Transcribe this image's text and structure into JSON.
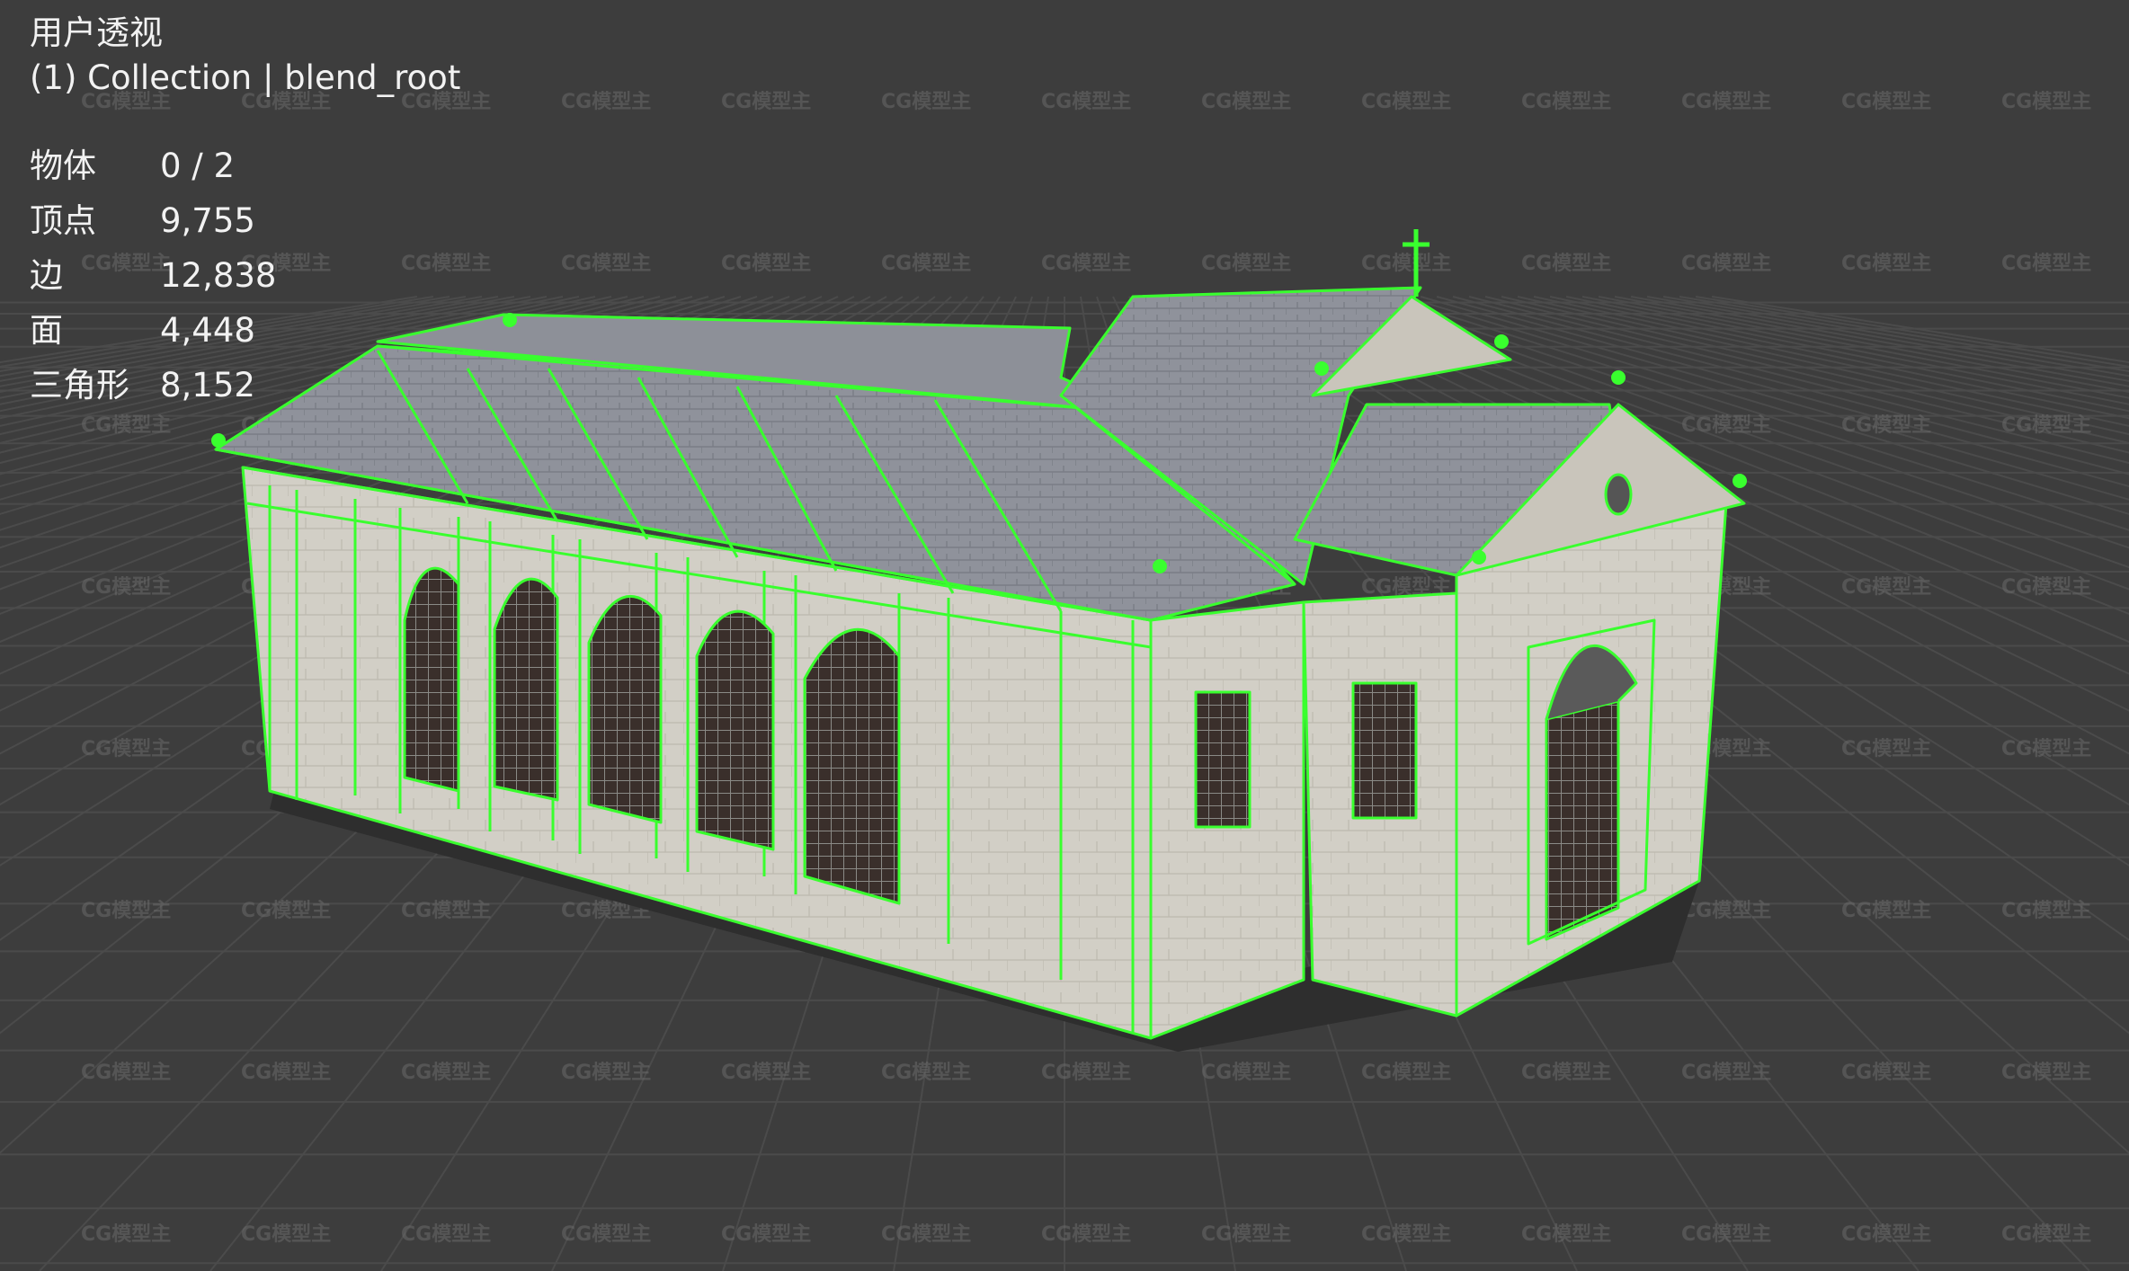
{
  "viewport": {
    "view_name": "用户透视",
    "collection_line": "(1) Collection | blend_root",
    "stats": [
      {
        "label": "物体",
        "value": "0 / 2"
      },
      {
        "label": "顶点",
        "value": "9,755"
      },
      {
        "label": "边",
        "value": "12,838"
      },
      {
        "label": "面",
        "value": "4,448"
      },
      {
        "label": "三角形",
        "value": "8,152"
      }
    ],
    "watermark_text": "CG模型主",
    "colors": {
      "background": "#3d3d3d",
      "grid": "#4b4b4b",
      "wire": "#39ff2e",
      "wall": "#cfccc3",
      "roof": "#9598a1"
    }
  }
}
